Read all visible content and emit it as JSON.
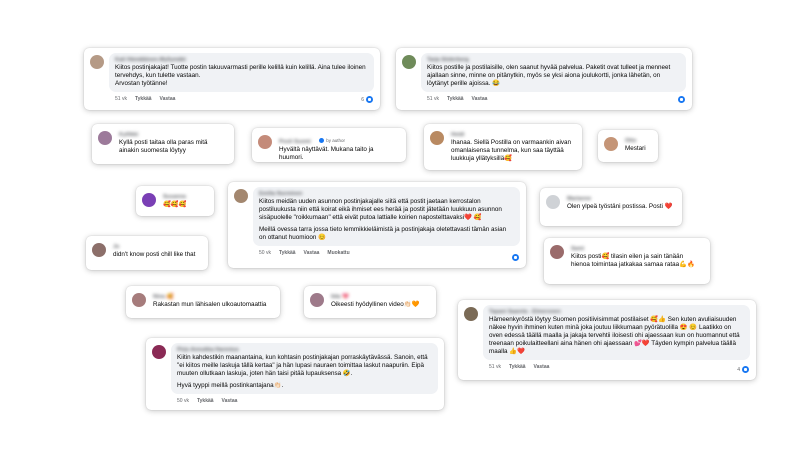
{
  "comments": [
    {
      "id": "c1",
      "author": "Kati Hämäläinen-Myllymäki",
      "avatar_color": "#b59a86",
      "paragraphs": [
        "Kiitos postinjakajat! Tuotte postin takuuvarmasti perille kelillä kuin kelillä. Aina tulee iloinen tervehdys, kun tulette vastaan.\nArvostan työtänne!"
      ],
      "time": "51 vk",
      "like": "Tykkää",
      "reply": "Vastaa",
      "reaction_count": "6"
    },
    {
      "id": "c2",
      "author": "Tarja Söderberg",
      "avatar_color": "#6f8b5a",
      "paragraphs": [
        "Kiitos postille ja postilaisille, olen saanut hyvää palvelua. Paketit ovat tulleet ja menneet ajallaan sinne, minne on pitänytkin, myös se yksi aiona joulukortti, jonka lähetän, on löytänyt perille ajoissa. 😂"
      ],
      "time": "51 vk",
      "like": "Tykkää",
      "reply": "Vastaa"
    },
    {
      "id": "c3",
      "author": "Kyllikki",
      "avatar_color": "#9c7a9a",
      "paragraphs": [
        "Kyllä posti taitaa olla paras mitä ainakin suomesta löytyy"
      ]
    },
    {
      "id": "c4",
      "author": "Posti Suomi",
      "badge": "by author",
      "avatar_color": "#c48b7a",
      "paragraphs": [
        "Hyvältä näyttävät. Mukana taito ja huumori."
      ]
    },
    {
      "id": "c5",
      "author": "Heidi",
      "avatar_color": "#b98a62",
      "paragraphs": [
        "Ihanaa. Siellä Postilla on varmaankin aivan omanlaisensa tunnelma, kun saa täyttää luukkuja yllätyksillä🥰"
      ]
    },
    {
      "id": "c6",
      "author": "Otto",
      "avatar_color": "#c59577",
      "paragraphs": [
        "Mestari"
      ]
    },
    {
      "id": "c7",
      "author": "Susanna",
      "avatar_color": "#7a3fb5",
      "paragraphs": [
        "🥰🥰🥰"
      ]
    },
    {
      "id": "c8",
      "author": "Emilia Nurminen",
      "avatar_color": "#a3876f",
      "paragraphs": [
        "Kiitos meidän uuden asunnon postinjakajalle siitä että postit jaetaan kerrostalon postiluukusta niin että koirat eikä ihmiset ees herää ja postit jätetään luukkuun asunnon sisäpuolelle \"roikkumaan\" että eivät putoa lattialle koirien napostelttavaksi❤️ 🥰",
        "Meillä ovessa tarra jossa tieto lemmikkieläimistä ja postinjakaja oletettavasti tämän asian on ottanut huomioon 😊"
      ],
      "time": "50 vk",
      "like": "Tykkää",
      "reply": "Vastaa",
      "edited": "Muokattu"
    },
    {
      "id": "c9",
      "author": "Marianne",
      "avatar_color": "#cfd2d6",
      "paragraphs": [
        "Olen ylpeä työstäni postissa. Posti ❤️"
      ]
    },
    {
      "id": "c10",
      "author": "Jo",
      "avatar_color": "#8c6f6a",
      "paragraphs": [
        "didn't know posti chill like that"
      ]
    },
    {
      "id": "c11",
      "author": "Sami",
      "avatar_color": "#9a6b6b",
      "paragraphs": [
        "Kiitos posti🥰 tilasin eilen ja sain tänään hienoa toimintaa jatkakaa samaa rataa💪🔥"
      ]
    },
    {
      "id": "c12",
      "author": "Nina 🥰",
      "avatar_color": "#a67c7c",
      "paragraphs": [
        "Rakastan mun lähisalen ulkoautomaattia"
      ]
    },
    {
      "id": "c13",
      "author": "Iida 💖",
      "avatar_color": "#9e7a8a",
      "paragraphs": [
        "Oikeesti hyödyllinen video👏🏻🧡"
      ]
    },
    {
      "id": "c14",
      "author": "Tapani Saarela - Elmeronen",
      "avatar_color": "#7a6a56",
      "paragraphs": [
        "Hämeenkyröstä löytyy Suomen positiivisimmat postilaiset 🥰👍 Sen kuten avuliaisuuden näkee hyvin ihminen kuten minä joka joutuu liikkumaan pyörätuolilla 😍 😊 Laatikko on oven edessä täällä maalla ja jakaja tervehtii iloisesti ohi ajaessaan kun on huomannut että treenaan poikulaitteellani aina hänen ohi ajaessaan 💕❤️ Täyden kympin palvelua täällä maalla 👍❤️"
      ],
      "time": "51 vk",
      "like": "Tykkää",
      "reply": "Vastaa",
      "reaction_count": "4"
    },
    {
      "id": "c15",
      "author": "Pirjo Annukka Harenius",
      "avatar_color": "#8a2a55",
      "paragraphs": [
        "Kiitin kahdestikin maanantaina, kun kohtasin postinjakajan porraskäytävässä. Sanoin, että \"ei kiitos meille laskuja tällä kertaa\" ja hän lupasi nauraen toimittaa laskut naapuriin. Eipä muuten ollutkaan laskuja, joten hän taisi pitää lupauksensa 🤣.",
        "Hyvä tyyppi meillä postinkantajana👏🏻."
      ],
      "time": "50 vk",
      "like": "Tykkää",
      "reply": "Vastaa"
    }
  ]
}
